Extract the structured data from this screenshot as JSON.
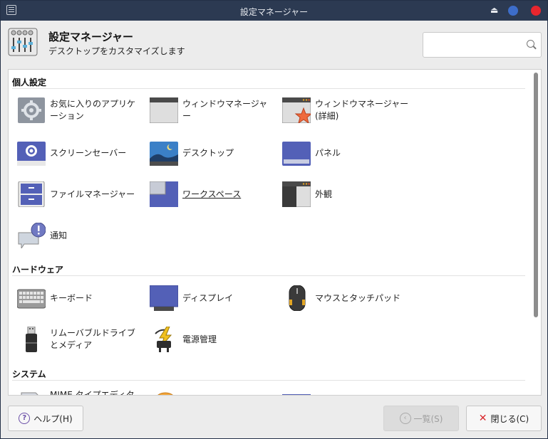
{
  "window": {
    "title": "設定マネージャー"
  },
  "header": {
    "title": "設定マネージャー",
    "subtitle": "デスクトップをカスタマイズします",
    "search_placeholder": ""
  },
  "sections": [
    {
      "title": "個人設定",
      "items": [
        {
          "label": "お気に入りのアプリケ\nーション",
          "icon": "gear-icon"
        },
        {
          "label": "ウィンドウマネージャー",
          "icon": "window-manager-icon"
        },
        {
          "label": "ウィンドウマネージャー\n(詳細)",
          "icon": "window-tweaks-icon"
        },
        {
          "label": "スクリーンセーバー",
          "icon": "screensaver-icon"
        },
        {
          "label": "デスクトップ",
          "icon": "desktop-icon"
        },
        {
          "label": "パネル",
          "icon": "panel-icon"
        },
        {
          "label": "ファイルマネージャー",
          "icon": "file-manager-icon"
        },
        {
          "label": "ワークスペース",
          "icon": "workspace-icon"
        },
        {
          "label": "外観",
          "icon": "appearance-icon"
        },
        {
          "label": "通知",
          "icon": "notification-icon"
        }
      ]
    },
    {
      "title": "ハードウェア",
      "items": [
        {
          "label": "キーボード",
          "icon": "keyboard-icon"
        },
        {
          "label": "ディスプレイ",
          "icon": "display-icon"
        },
        {
          "label": "マウスとタッチパッド",
          "icon": "mouse-icon"
        },
        {
          "label": "リムーバブルドライブ\nとメディア",
          "icon": "removable-drive-icon"
        },
        {
          "label": "電源管理",
          "icon": "power-manager-icon"
        }
      ]
    },
    {
      "title": "システム",
      "items": [
        {
          "label": "MIME タイプエディタ",
          "icon": "mime-icon"
        },
        {
          "label": "",
          "icon": "accessibility-icon"
        },
        {
          "label": "",
          "icon": "system-icon"
        }
      ]
    }
  ],
  "footer": {
    "help_label": "ヘルプ(H)",
    "back_label": "一覧(S)",
    "close_label": "閉じる(C)"
  },
  "colors": {
    "titlebar": "#2c3a52",
    "accent_blue": "#5360b7",
    "close_red": "#e8262e"
  }
}
